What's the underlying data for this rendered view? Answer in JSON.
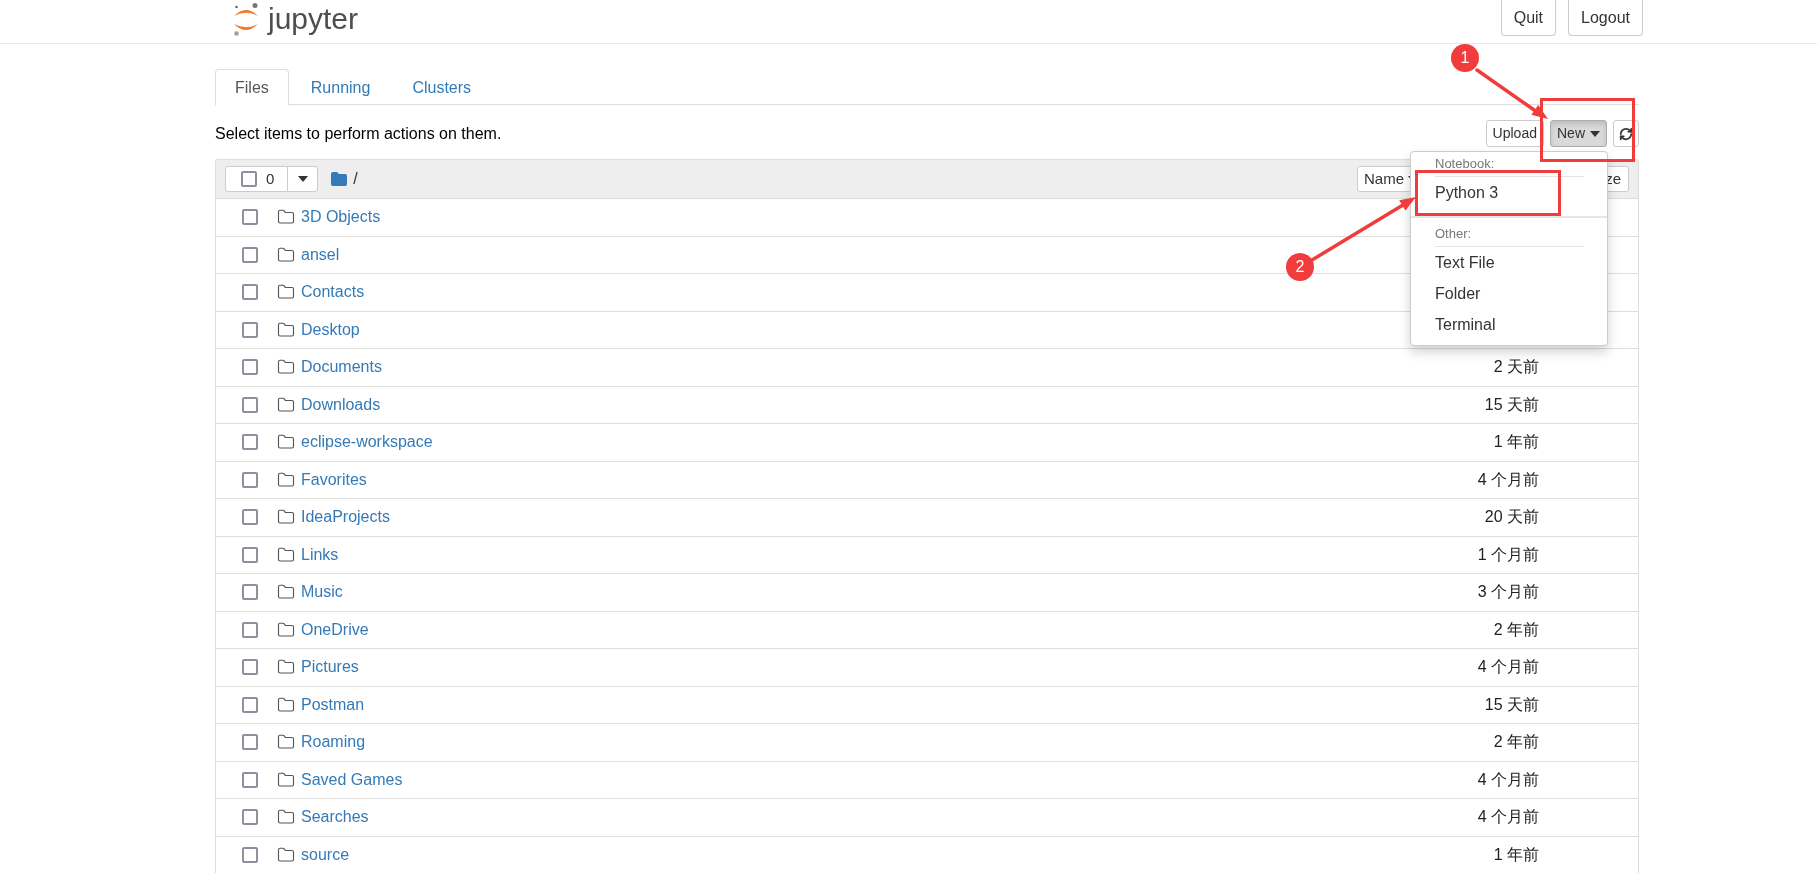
{
  "header": {
    "logo_text": "jupyter",
    "buttons": [
      "Quit",
      "Logout"
    ]
  },
  "tabs": [
    {
      "label": "Files",
      "selected": true
    },
    {
      "label": "Running",
      "selected": false
    },
    {
      "label": "Clusters",
      "selected": false
    }
  ],
  "toolbar": {
    "hint": "Select items to perform actions on them.",
    "buttons": [
      {
        "label": "Upload",
        "active": false,
        "dropdown": false
      },
      {
        "label": "New",
        "active": true,
        "dropdown": true
      }
    ]
  },
  "table_header": {
    "select_checked": false,
    "selected_count": "0",
    "path": "/",
    "sort_buttons": [
      {
        "label": "Name",
        "sorted": true
      },
      {
        "label": "ze",
        "sorted": false
      }
    ]
  },
  "rows": [
    {
      "name": "3D Objects",
      "checked": false
    },
    {
      "name": "ansel",
      "checked": false
    },
    {
      "name": "Contacts",
      "checked": false
    },
    {
      "name": "Desktop",
      "checked": false
    },
    {
      "name": "Documents",
      "modified": "2 天前",
      "checked": false
    },
    {
      "name": "Downloads",
      "modified": "15 天前",
      "checked": false
    },
    {
      "name": "eclipse-workspace",
      "modified": "1 年前",
      "checked": false
    },
    {
      "name": "Favorites",
      "modified": "4 个月前",
      "checked": false
    },
    {
      "name": "IdeaProjects",
      "modified": "20 天前",
      "checked": false
    },
    {
      "name": "Links",
      "modified": "1 个月前",
      "checked": false
    },
    {
      "name": "Music",
      "modified": "3 个月前",
      "checked": false
    },
    {
      "name": "OneDrive",
      "modified": "2 年前",
      "checked": false
    },
    {
      "name": "Pictures",
      "modified": "4 个月前",
      "checked": false
    },
    {
      "name": "Postman",
      "modified": "15 天前",
      "checked": false
    },
    {
      "name": "Roaming",
      "modified": "2 年前",
      "checked": false
    },
    {
      "name": "Saved Games",
      "modified": "4 个月前",
      "checked": false
    },
    {
      "name": "Searches",
      "modified": "4 个月前",
      "checked": false
    },
    {
      "name": "source",
      "modified": "1 年前",
      "checked": false
    }
  ],
  "menu": {
    "sections": [
      {
        "header": "Notebook:",
        "items": [
          "Python 3"
        ]
      },
      {
        "header": "Other:",
        "items": [
          "Text File",
          "Folder",
          "Terminal"
        ]
      }
    ]
  },
  "annotations": [
    {
      "label": "1"
    },
    {
      "label": "2"
    }
  ]
}
